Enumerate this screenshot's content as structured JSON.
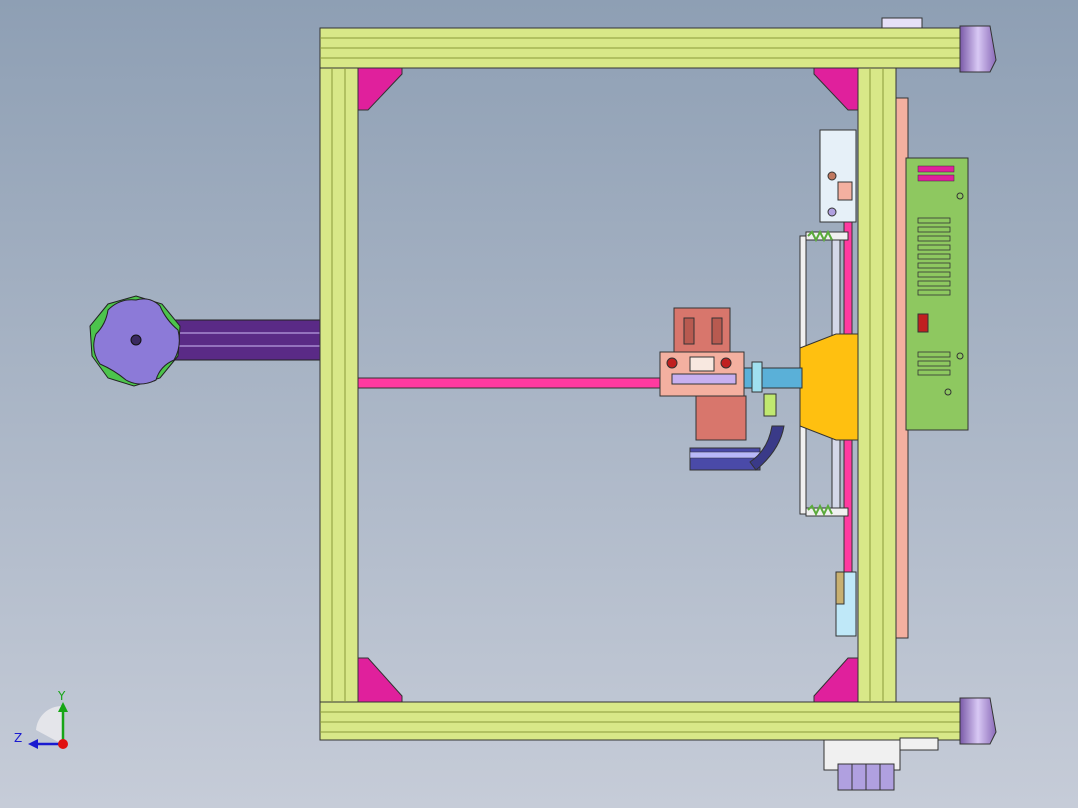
{
  "viewport": {
    "background_top": "#8e9fb4",
    "background_bottom": "#c6ccd8"
  },
  "triad": {
    "y_label": "Y",
    "z_label": "Z",
    "y_color": "#16a516",
    "z_color": "#1a1ad0",
    "x_color": "#e01010"
  },
  "colors": {
    "frame": "#d8e888",
    "frame_dark": "#8a9a3a",
    "bracket": "#e0209c",
    "rod": "#ff3aa0",
    "knob": "#8c7ad8",
    "knob_accent": "#4cc44c",
    "shaft": "#5a2a86",
    "board": "#8ec860",
    "slider": "#ffc010",
    "motor": "#d8766c",
    "foot": "#b8a0e0",
    "spring": "#5aaa3a",
    "plate_pink": "#f4b0a0"
  },
  "icons": [
    "axis-triad-icon"
  ]
}
